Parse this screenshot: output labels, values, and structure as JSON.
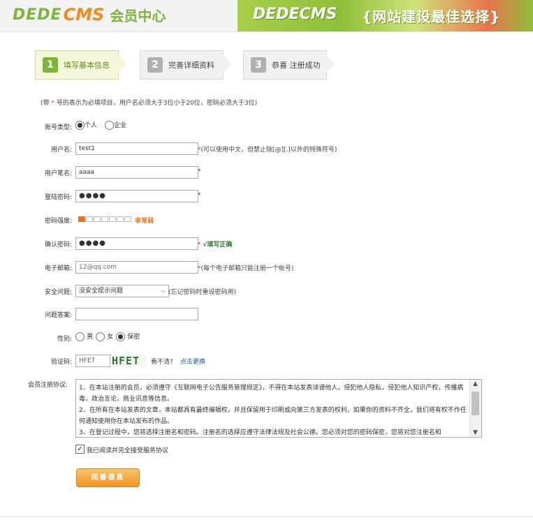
{
  "header": {
    "logo_dede": "DEDE",
    "logo_cms": "CMS",
    "logo_sub": "会员中心",
    "banner_logo": "DEDECMS",
    "banner_tagline": "{网站建设最佳选择}"
  },
  "steps": [
    {
      "num": "1",
      "label": "填写基本信息",
      "active": true
    },
    {
      "num": "2",
      "label": "完善详细资料",
      "active": false
    },
    {
      "num": "3",
      "label": "恭喜 注册成功",
      "active": false
    }
  ],
  "note": {
    "pre": "(带 ",
    "star": "*",
    "post": " 号的表示为必填项目，用户名必须大于3位小于20位，密码必须大于3位)"
  },
  "form": {
    "account_type": {
      "label": "账号类型:",
      "opt_personal": "个人",
      "opt_company": "企业",
      "selected": "个人"
    },
    "username": {
      "label": "用户名:",
      "value": "test1",
      "hint": "(可以使用中文，但禁止除[@][.]以外的特殊符号)"
    },
    "nickname": {
      "label": "用户笔名:",
      "value": "aaaa"
    },
    "password": {
      "label": "登陆密码:",
      "value": "●●●●"
    },
    "strength": {
      "label": "密码强度:",
      "level_text": "非常弱",
      "filled_segments": 1,
      "total_segments": 7
    },
    "confirm": {
      "label": "确认密码:",
      "value": "●●●●",
      "ok_text": "√填写正确"
    },
    "email": {
      "label": "电子邮箱:",
      "value": "12@qq.com",
      "hint": "(每个电子邮箱只能注册一个帐号)"
    },
    "question": {
      "label": "安全问题:",
      "value": "没安全提示问题",
      "hint": "(忘记密码时重设密码用)"
    },
    "answer": {
      "label": "问题答案:",
      "value": ""
    },
    "gender": {
      "label": "性别:",
      "opt_male": "男",
      "opt_female": "女",
      "opt_secret": "保密",
      "selected": "保密"
    },
    "captcha": {
      "label": "验证码:",
      "value": "HFET",
      "image_text": "HFET",
      "unclear": "看不清?",
      "refresh": "点击更换"
    },
    "agreement": {
      "label": "会员注册协议:",
      "lines": [
        "1、在本站注册的会员，必须遵守《互联网电子公告服务管理规定》，不得在本站发表诽谤他人，侵犯他人隐私，侵犯他人知识产权，传播病毒，政治言论，商业讯息等信息。",
        "2、在所有在本站发表的文章，本站都具有最终编辑权，并且保留用于印刷或向第三方发表的权利，如果你的资料不齐全，我们将有权不作任何通知使用你在本站发布的作品。",
        "3、在登记过程中，您将选择注册名和密码。注册名的选择应遵守法律法规及社会公德。您必须对您的密码保密，您将对您注册名和"
      ]
    },
    "accept_label": "我已阅读并完全接受服务协议",
    "submit_label": "完善信息"
  }
}
